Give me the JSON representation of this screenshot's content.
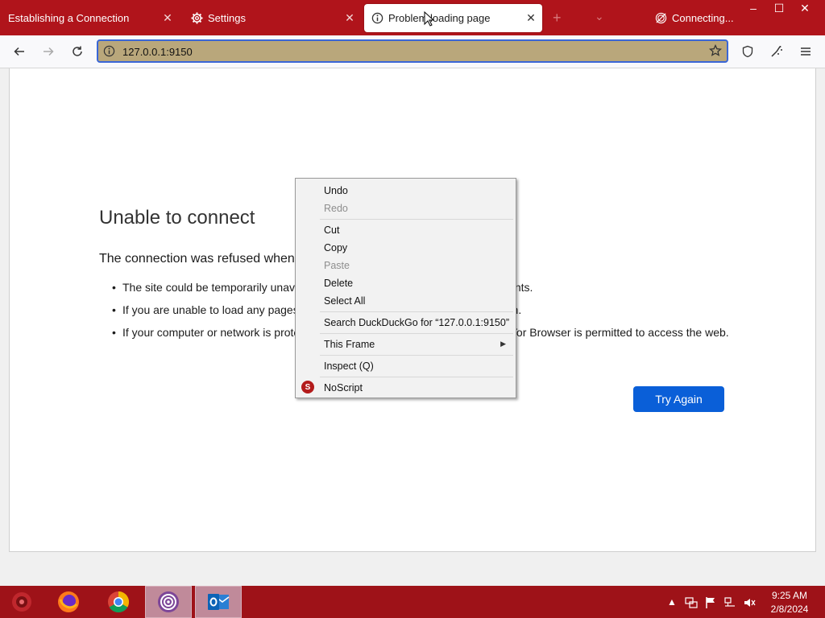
{
  "tabs": [
    {
      "title": "Establishing a Connection",
      "icon": "none"
    },
    {
      "title": "Settings",
      "icon": "gear-icon"
    },
    {
      "title": "Problem loading page",
      "icon": "info-icon",
      "active": true
    },
    {
      "title": "Connecting...",
      "icon": "onion-icon"
    }
  ],
  "tab_close_glyph": "✕",
  "new_tab_glyph": "+",
  "tab_list_glyph": "⌄",
  "window_controls": {
    "minimize": "–",
    "maximize": "☐",
    "close": "✕"
  },
  "urlbar": {
    "value": "127.0.0.1:9150"
  },
  "error_page": {
    "title": "Unable to connect",
    "description": "The connection was refused when attempting to contact 127.0.0.1:9150.",
    "bullets": [
      "The site could be temporarily unavailable or too busy. Try again in a few moments.",
      "If you are unable to load any pages, check your computer’s network connection.",
      "If your computer or network is protected by a firewall or proxy, make sure that Tor Browser is permitted to access the web."
    ],
    "try_again_label": "Try Again"
  },
  "context_menu": {
    "undo": "Undo",
    "redo": "Redo",
    "cut": "Cut",
    "copy": "Copy",
    "paste": "Paste",
    "delete": "Delete",
    "select_all": "Select All",
    "search": "Search DuckDuckGo for “127.0.0.1:9150”",
    "this_frame": "This Frame",
    "inspect": "Inspect (Q)",
    "noscript": "NoScript",
    "submenu_arrow": "▶"
  },
  "taskbar": {
    "apps": [
      "firefox-icon",
      "chrome-icon",
      "tor-browser-icon",
      "outlook-icon"
    ],
    "time": "9:25 AM",
    "date": "2/8/2024"
  },
  "colors": {
    "tabbar": "#b0141b",
    "taskbar": "#9e1218",
    "accent": "#0a5fd8",
    "urlbar_bg": "#b9a77b"
  }
}
